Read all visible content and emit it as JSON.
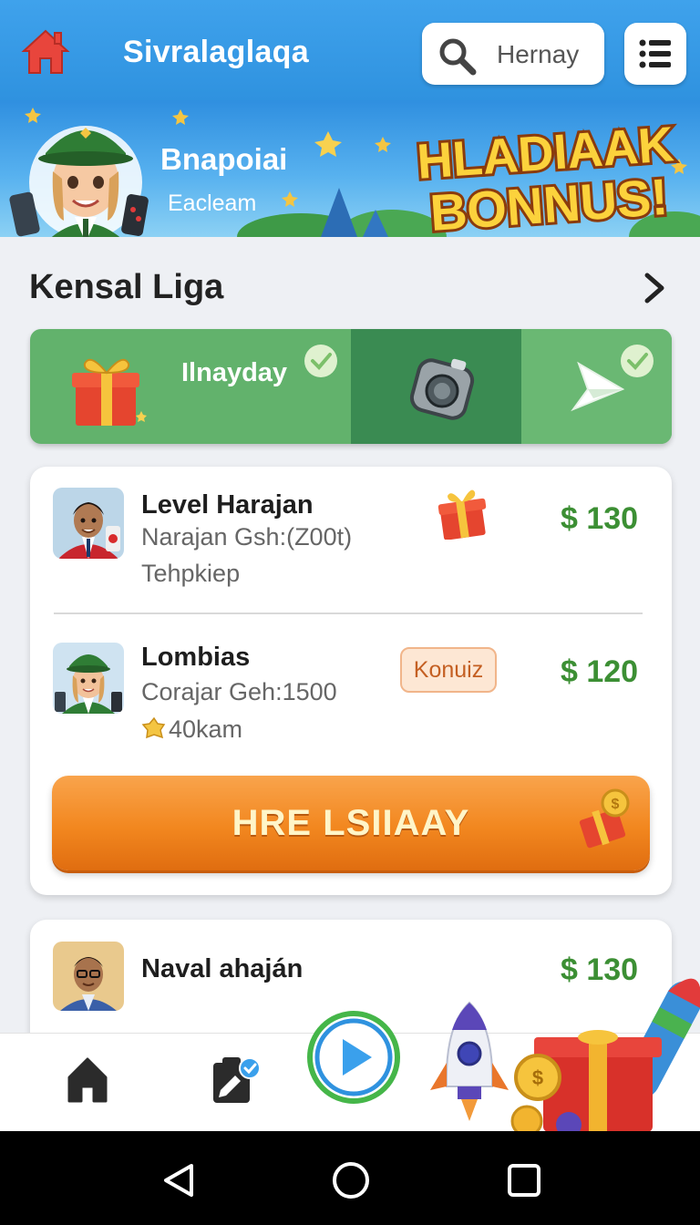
{
  "app": {
    "title": "Sivralaglaqa",
    "search_text": "Hernay"
  },
  "banner": {
    "name": "Bnapoiai",
    "subtitle": "Eacleam",
    "bonus_line1": "HLADIAAK",
    "bonus_line2": "BONNUS!"
  },
  "section": {
    "title": "Kensal Liga"
  },
  "daily": {
    "label": "Ilnayday"
  },
  "leaders": [
    {
      "name": "Level Harajan",
      "sub": "Narajan Gsh:(Z00t)",
      "sub2": "Tehpkiep",
      "price": "$ 130"
    },
    {
      "name": "Lombias",
      "sub": "Corajar Geh:1500",
      "sub2": "40kam",
      "badge": "Konuiz",
      "price": "$ 120"
    }
  ],
  "cta": {
    "label": "HRE LSIIAAY"
  },
  "leader3": {
    "name": "Naval ahaján",
    "price": "$ 130"
  },
  "colors": {
    "appbar": "#3fa2ec",
    "accent_green": "#3c8f34",
    "cta_orange": "#f2871f",
    "strip_green": "#62b26c"
  },
  "icons": [
    "home-logo-icon",
    "search-icon",
    "menu-icon",
    "chevron-right-icon",
    "gift-icon",
    "check-icon",
    "camera-icon",
    "paper-plane-icon",
    "coin-icon",
    "home-icon",
    "tasks-icon",
    "play-icon",
    "rocket-icon",
    "back-icon",
    "circle-home-icon",
    "recents-icon"
  ]
}
